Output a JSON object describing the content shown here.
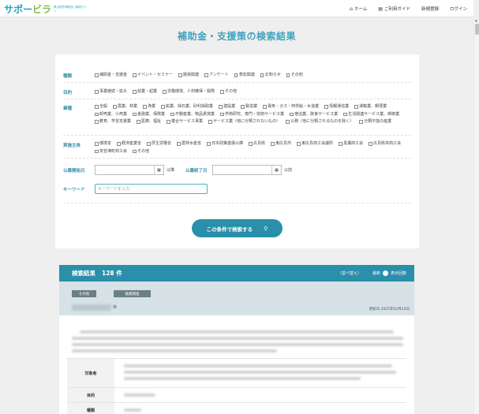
{
  "header": {
    "logo_main": "サポー",
    "logo_accent": "ビラ",
    "logo_sub": "県出資外郭財団 | 助成サイト",
    "nav": [
      {
        "icon": "home-icon",
        "glyph": "⌂",
        "label": "ホーム"
      },
      {
        "icon": "guide-icon",
        "glyph": "▤",
        "label": "ご利用ガイド"
      },
      {
        "icon": "",
        "glyph": "",
        "label": "新規登録"
      },
      {
        "icon": "",
        "glyph": "",
        "label": "ログイン"
      }
    ]
  },
  "page_title": "補助金・支援策の検索結果",
  "form": {
    "category": {
      "label": "種類",
      "options": [
        "補助金・支援金",
        "イベント・セミナー",
        "融資関連",
        "アンケート",
        "表彰関連",
        "お知らせ",
        "その他"
      ]
    },
    "purpose": {
      "label": "目的",
      "options": [
        "事業継続・拡大",
        "創業・起業",
        "労働環境、人材確保・開発",
        "その他"
      ]
    },
    "industry": {
      "label": "業種",
      "options": [
        "全般",
        "農業、林業",
        "漁業",
        "鉱業、採石業、砂利採取業",
        "建設業",
        "製造業",
        "電気・ガス・熱供給・水道業",
        "情報通信業",
        "運輸業、郵便業",
        "卸売業、小売業",
        "金融業、保険業",
        "不動産業、物品賃貸業",
        "学術研究、専門・技術サービス業",
        "宿泊業、飲食サービス業",
        "生活関連サービス業、娯楽業",
        "教育、学習支援業",
        "医療、福祉",
        "複合サービス事業",
        "サービス業（他に分類されないもの）",
        "公務（他に分類されるものを除く）",
        "分類不能の産業"
      ]
    },
    "organizer": {
      "label": "実施主体",
      "options": [
        "環境省",
        "経済産業省",
        "厚生労働省",
        "農林水産省",
        "日本政策金融公庫",
        "広島県",
        "東広島市",
        "東広島商工会議所",
        "黒瀬商工会",
        "広島県央商工会",
        "安芸津町商工会",
        "その他"
      ]
    },
    "date_start_label": "公募開始日",
    "date_start_suffix": "以降",
    "date_end_label": "公募終了日",
    "date_end_suffix": "以前",
    "calendar_glyph": "▦",
    "keyword_label": "キーワード",
    "keyword_placeholder": "キーワードを入力",
    "search_button": "この条件で検索する",
    "search_glyph": "⚲"
  },
  "results": {
    "title": "検索結果",
    "count": "128 件",
    "sort_label": "（並べ替え）",
    "sort_new": "最新",
    "sort_views": "表示回数"
  },
  "card": {
    "tags": [
      "その他",
      "融資関連"
    ],
    "title_suffix": "等",
    "updated": "更新日 2025年02月24日",
    "rows": [
      {
        "label": "対象者"
      },
      {
        "label": "目的"
      },
      {
        "label": "種類"
      }
    ]
  },
  "colors": {
    "accent": "#2a8fa9",
    "title": "#3fa2bc",
    "label": "#3a8fa8"
  }
}
